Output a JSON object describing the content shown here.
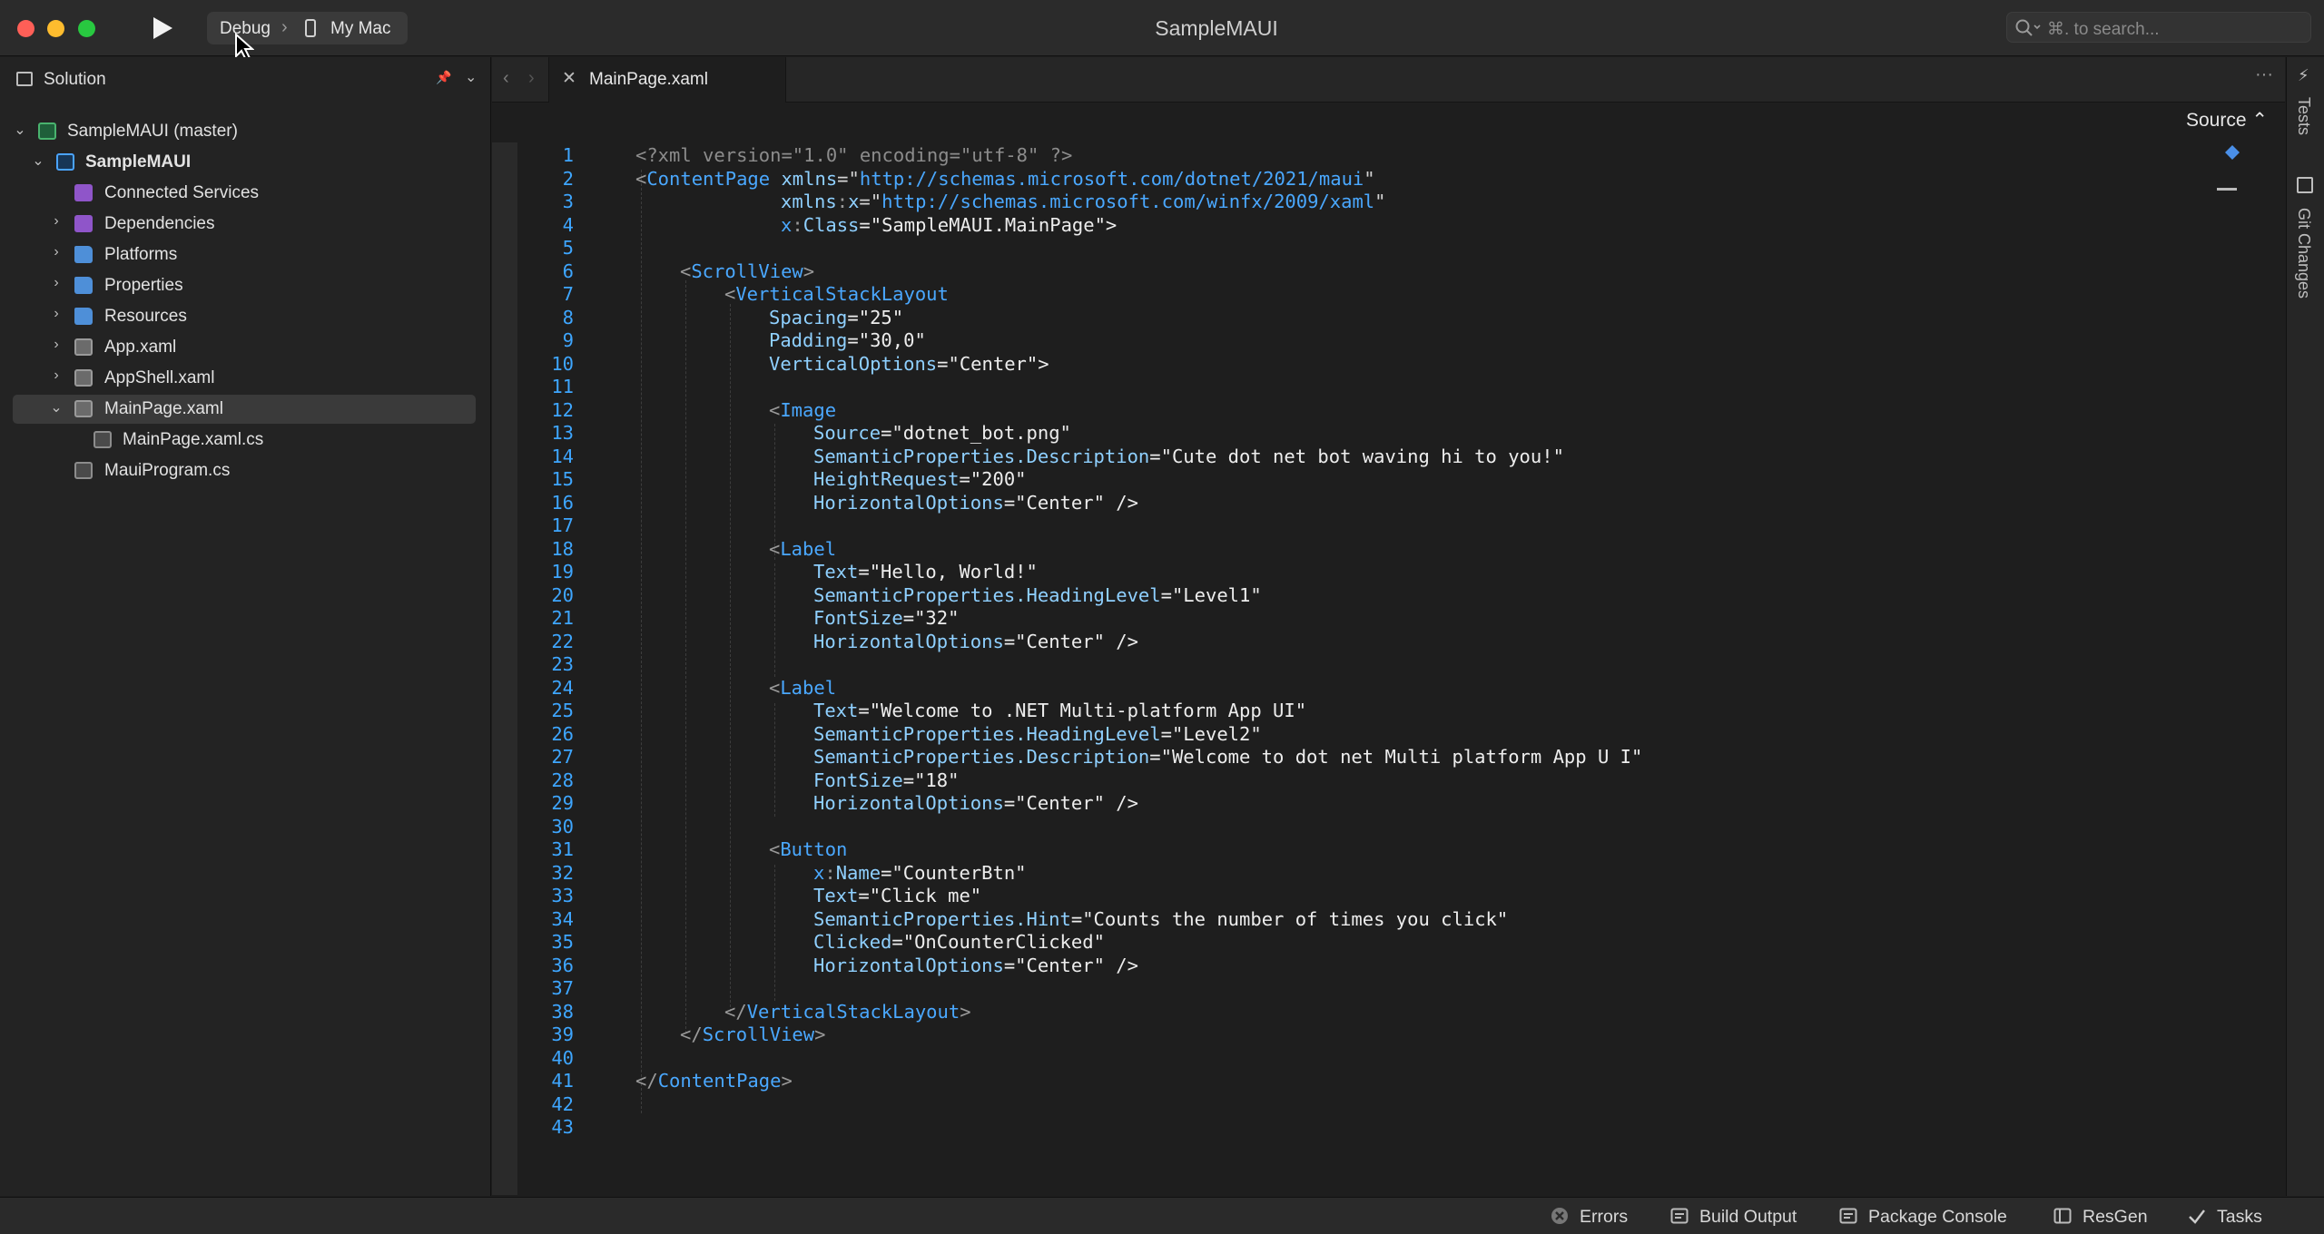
{
  "titlebar": {
    "app_title": "SampleMAUI",
    "configuration": "Debug",
    "separator": "›",
    "device": "My Mac",
    "search_placeholder": "⌘. to search..."
  },
  "solution_pad": {
    "title": "Solution",
    "tree": [
      {
        "label": "SampleMAUI (master)",
        "icon": "solution-icon",
        "expanded": true
      },
      {
        "label": "SampleMAUI",
        "icon": "project-icon",
        "expanded": true
      },
      {
        "label": "Connected Services",
        "icon": "connected-services-icon"
      },
      {
        "label": "Dependencies",
        "icon": "dependencies-icon",
        "expanded": false
      },
      {
        "label": "Platforms",
        "icon": "folder-icon",
        "expanded": false
      },
      {
        "label": "Properties",
        "icon": "folder-icon",
        "expanded": false
      },
      {
        "label": "Resources",
        "icon": "folder-icon",
        "expanded": false
      },
      {
        "label": "App.xaml",
        "icon": "xaml-file-icon",
        "expanded": false
      },
      {
        "label": "AppShell.xaml",
        "icon": "xaml-file-icon",
        "expanded": false
      },
      {
        "label": "MainPage.xaml",
        "icon": "xaml-file-icon",
        "expanded": true,
        "selected": true
      },
      {
        "label": "MainPage.xaml.cs",
        "icon": "cs-file-icon"
      },
      {
        "label": "MauiProgram.cs",
        "icon": "cs-file-icon"
      }
    ]
  },
  "editor": {
    "tab_label": "MainPage.xaml",
    "view_selector": "Source",
    "line_numbers": [
      "1",
      "2",
      "3",
      "4",
      "5",
      "6",
      "7",
      "8",
      "9",
      "10",
      "11",
      "12",
      "13",
      "14",
      "15",
      "16",
      "17",
      "18",
      "19",
      "20",
      "21",
      "22",
      "23",
      "24",
      "25",
      "26",
      "27",
      "28",
      "29",
      "30",
      "31",
      "32",
      "33",
      "34",
      "35",
      "36",
      "37",
      "38",
      "39",
      "40",
      "41",
      "42",
      "43"
    ],
    "code": {
      "l1a": "<?xml version=\"1.0\" encoding=\"utf-8\" ?>",
      "l2a": "<",
      "l2b": "ContentPage",
      "l2c": " ",
      "l2d": "xmlns",
      "l2e": "=\"",
      "l2f": "http://schemas.microsoft.com/dotnet/2021/maui",
      "l2g": "\"",
      "l3a": "xmlns",
      "l3b": ":",
      "l3c": "x",
      "l3d": "=\"",
      "l3e": "http://schemas.microsoft.com/winfx/2009/xaml",
      "l3f": "\"",
      "l4a": "x",
      "l4b": ":",
      "l4c": "Class",
      "l4d": "=\"SampleMAUI.MainPage\">",
      "l6a": "<",
      "l6b": "ScrollView",
      "l6c": ">",
      "l7a": "<",
      "l7b": "VerticalStackLayout",
      "l8a": "Spacing",
      "l8b": "=\"25\"",
      "l9a": "Padding",
      "l9b": "=\"30,0\"",
      "l10a": "VerticalOptions",
      "l10b": "=\"Center\">",
      "l12a": "<",
      "l12b": "Image",
      "l13a": "Source",
      "l13b": "=\"dotnet_bot.png\"",
      "l14a": "SemanticProperties.Description",
      "l14b": "=\"Cute dot net bot waving hi to you!\"",
      "l15a": "HeightRequest",
      "l15b": "=\"200\"",
      "l16a": "HorizontalOptions",
      "l16b": "=\"Center\" />",
      "l18a": "<",
      "l18b": "Label",
      "l19a": "Text",
      "l19b": "=\"Hello, World!\"",
      "l20a": "SemanticProperties.HeadingLevel",
      "l20b": "=\"Level1\"",
      "l21a": "FontSize",
      "l21b": "=\"32\"",
      "l22a": "HorizontalOptions",
      "l22b": "=\"Center\" />",
      "l24a": "<",
      "l24b": "Label",
      "l25a": "Text",
      "l25b": "=\"Welcome to .NET Multi-platform App UI\"",
      "l26a": "SemanticProperties.HeadingLevel",
      "l26b": "=\"Level2\"",
      "l27a": "SemanticProperties.Description",
      "l27b": "=\"Welcome to dot net Multi platform App U I\"",
      "l28a": "FontSize",
      "l28b": "=\"18\"",
      "l29a": "HorizontalOptions",
      "l29b": "=\"Center\" />",
      "l31a": "<",
      "l31b": "Button",
      "l32a": "x",
      "l32b": ":",
      "l32c": "Name",
      "l32d": "=\"CounterBtn\"",
      "l33a": "Text",
      "l33b": "=\"Click me\"",
      "l34a": "SemanticProperties.Hint",
      "l34b": "=\"Counts the number of times you click\"",
      "l35a": "Clicked",
      "l35b": "=\"OnCounterClicked\"",
      "l36a": "HorizontalOptions",
      "l36b": "=\"Center\" />",
      "l38a": "</",
      "l38b": "VerticalStackLayout",
      "l38c": ">",
      "l39a": "</",
      "l39b": "ScrollView",
      "l39c": ">",
      "l41a": "</",
      "l41b": "ContentPage",
      "l41c": ">"
    }
  },
  "right_pads": {
    "tests": "Tests",
    "git_changes": "Git Changes"
  },
  "statusbar": {
    "errors": "Errors",
    "build_output": "Build Output",
    "package_console": "Package Console",
    "resgen": "ResGen",
    "tasks": "Tasks"
  },
  "colors": {
    "background": "#1e1e1e",
    "tag": "#4aa8ff",
    "line_number": "#3ea6ff",
    "close": "#ff5f57",
    "minimize": "#febc2e",
    "maximize": "#28c840"
  }
}
